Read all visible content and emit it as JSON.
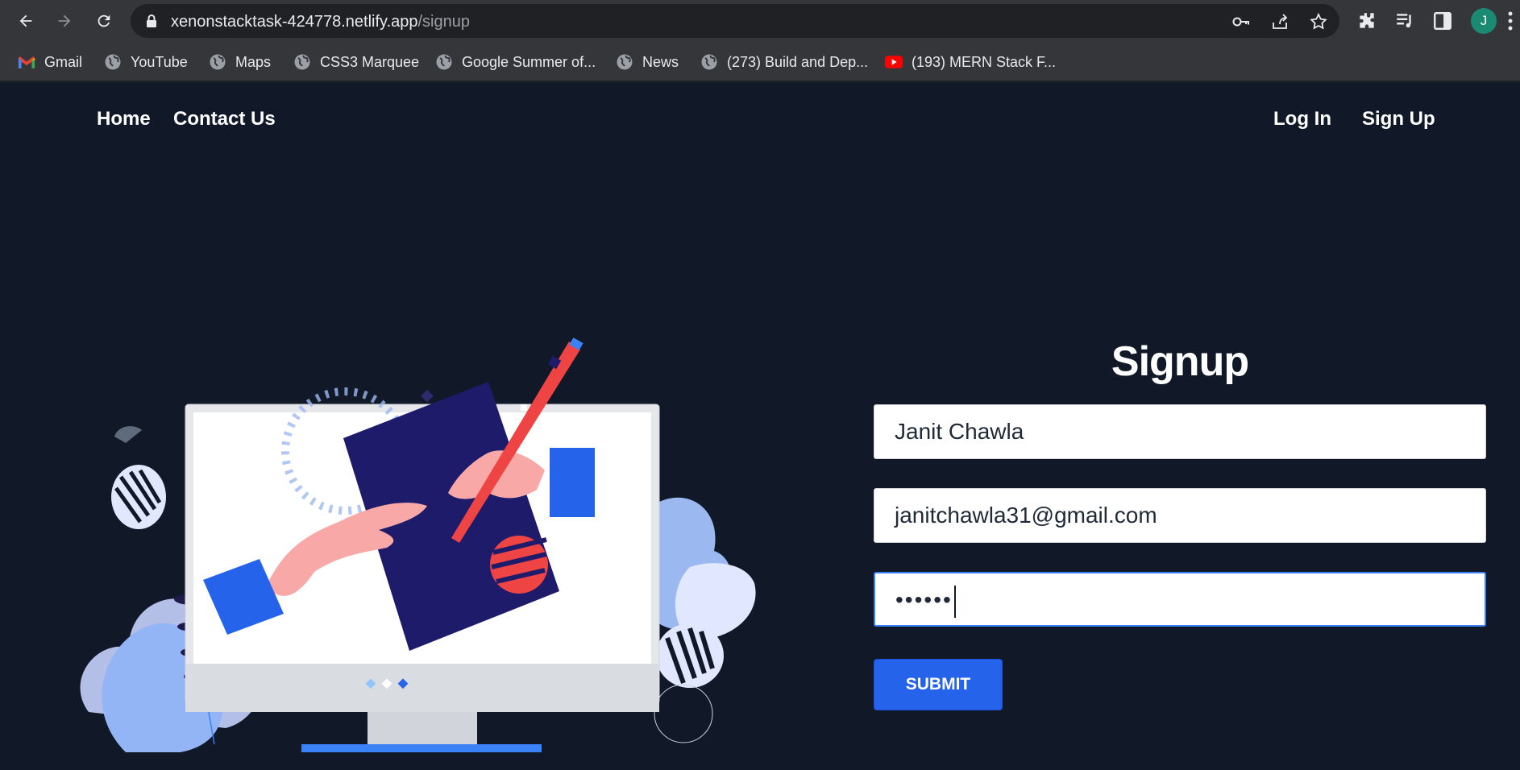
{
  "browser": {
    "url_host": "xenonstacktask-424778.netlify.app",
    "url_path": "/signup",
    "profile_initial": "J",
    "bookmarks": [
      {
        "label": "Gmail",
        "icon": "gmail-icon"
      },
      {
        "label": "YouTube",
        "icon": "globe-icon"
      },
      {
        "label": "Maps",
        "icon": "globe-icon"
      },
      {
        "label": "CSS3 Marquee",
        "icon": "globe-icon"
      },
      {
        "label": "Google Summer of...",
        "icon": "globe-icon"
      },
      {
        "label": "News",
        "icon": "globe-icon"
      },
      {
        "label": "(273) Build and Dep...",
        "icon": "globe-icon"
      },
      {
        "label": "(193) MERN Stack F...",
        "icon": "youtube-icon"
      }
    ]
  },
  "nav": {
    "home": "Home",
    "contact": "Contact Us",
    "login": "Log In",
    "signup": "Sign Up"
  },
  "form": {
    "title": "Signup",
    "name_value": "Janit Chawla",
    "email_value": "janitchawla31@gmail.com",
    "password_masked": "••••••",
    "submit_label": "SUBMIT"
  },
  "colors": {
    "page_bg": "#111827",
    "accent": "#2563eb",
    "chrome": "#35363a"
  }
}
